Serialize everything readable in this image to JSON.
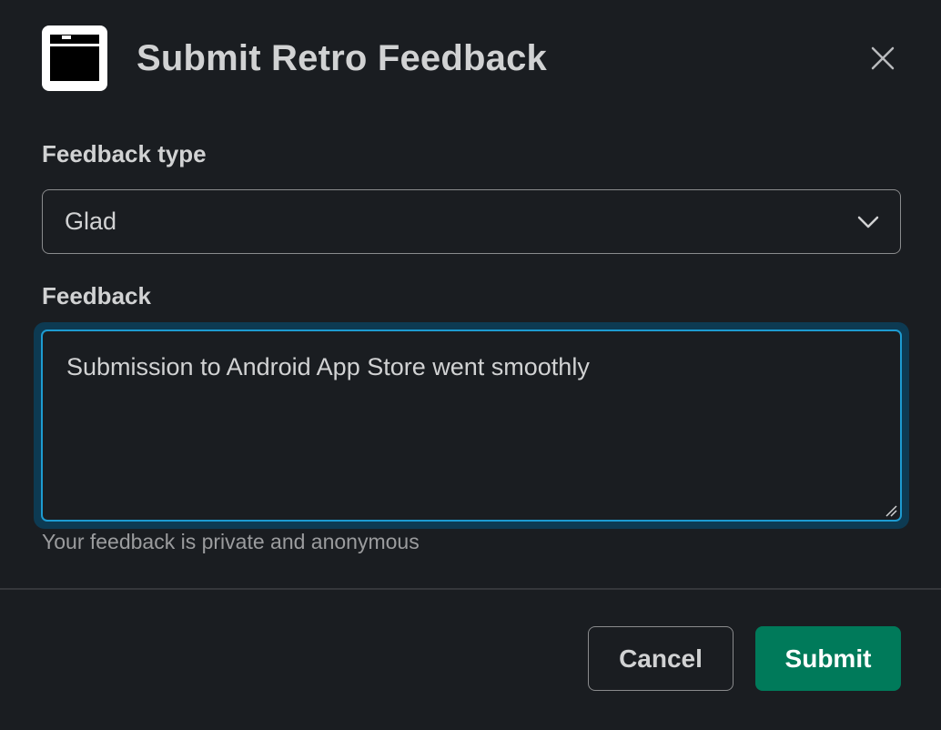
{
  "modal": {
    "title": "Submit Retro Feedback",
    "app_icon": "archive-box-icon",
    "close_icon": "close-icon"
  },
  "form": {
    "feedback_type": {
      "label": "Feedback type",
      "selected": "Glad",
      "icon": "chevron-down-icon"
    },
    "feedback": {
      "label": "Feedback",
      "value": "Submission to Android App Store went smoothly",
      "hint": "Your feedback is private and anonymous"
    }
  },
  "footer": {
    "cancel_label": "Cancel",
    "submit_label": "Submit"
  },
  "colors": {
    "background": "#1a1d21",
    "text": "#d1d2d3",
    "focus_border": "#1d9bd1",
    "submit_bg": "#007a5a"
  }
}
